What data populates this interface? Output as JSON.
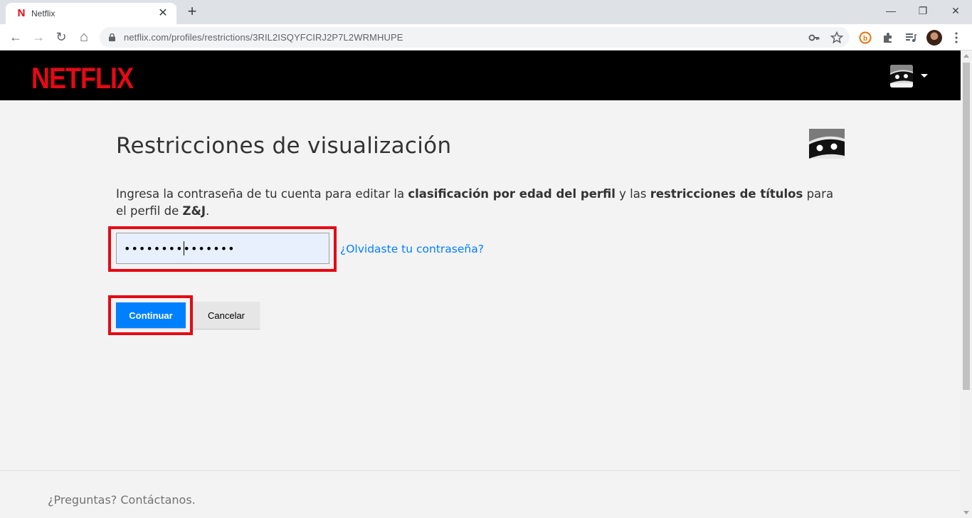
{
  "browser": {
    "tab_title": "Netflix",
    "tab_favicon": "N",
    "tab_close": "✕",
    "new_tab": "+",
    "url": "netflix.com/profiles/restrictions/3RIL2ISQYFCIRJ2P7L2WRMHUPE",
    "window_controls": {
      "minimize": "—",
      "restore": "❐",
      "close": "✕"
    },
    "nav": {
      "back": "←",
      "forward": "→",
      "reload": "↻",
      "home": "⌂"
    },
    "icons": [
      "key-icon",
      "star-icon",
      "extension-b-icon",
      "puzzle-icon",
      "media-icon",
      "menu-icon"
    ]
  },
  "header": {
    "logo": "NETFLIX",
    "logo_color": "#e50914"
  },
  "main": {
    "title": "Restricciones de visualización",
    "description": {
      "part1": "Ingresa la contraseña de tu cuenta para editar la ",
      "bold1": "clasificación por edad del perfil",
      "part2": " y las ",
      "bold2": "restricciones de títulos",
      "part3": " para el perfil de ",
      "profile": "Z&J",
      "part4": "."
    },
    "password_value": "•••••••••••••••",
    "forgot_link": "¿Olvidaste tu contraseña?",
    "continue_label": "Continuar",
    "cancel_label": "Cancelar",
    "accent_color": "#0080ff",
    "highlight_color": "#e50914"
  },
  "footer": {
    "contact": "¿Preguntas? Contáctanos."
  }
}
